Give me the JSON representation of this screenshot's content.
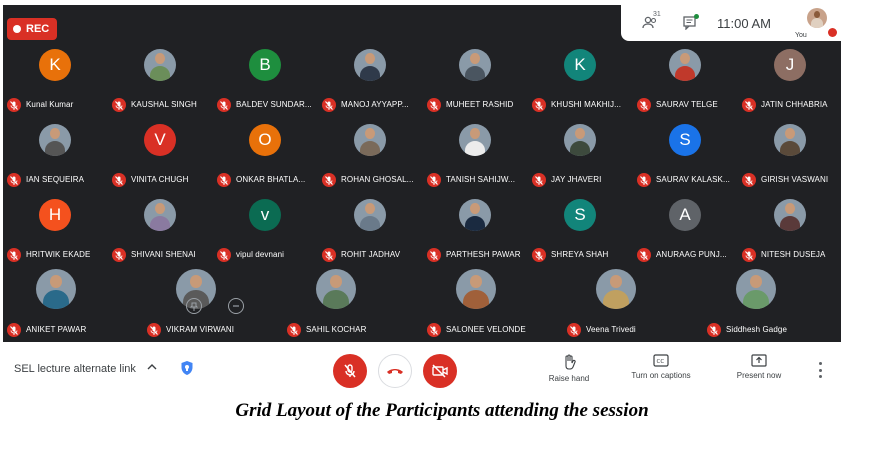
{
  "recording": {
    "label": "REC"
  },
  "top_panel": {
    "participant_count": "31",
    "clock": "11:00 AM",
    "self_label": "You"
  },
  "participants": [
    {
      "name": "Kunal Kumar",
      "avatar": "letter",
      "initial": "K",
      "color": "#e8710a"
    },
    {
      "name": "KAUSHAL SINGH",
      "avatar": "photo",
      "color": "#6b8e5a"
    },
    {
      "name": "BALDEV SUNDAR...",
      "avatar": "letter",
      "initial": "B",
      "color": "#1e8e3e"
    },
    {
      "name": "MANOJ AYYAPP...",
      "avatar": "photo",
      "color": "#2f3a4a"
    },
    {
      "name": "MUHEET RASHID",
      "avatar": "photo",
      "color": "#4a5560"
    },
    {
      "name": "KHUSHI MAKHIJ...",
      "avatar": "letter",
      "initial": "K",
      "color": "#12857a"
    },
    {
      "name": "SAURAV TELGE",
      "avatar": "photo",
      "color": "#c0392b"
    },
    {
      "name": "JATIN CHHABRIA",
      "avatar": "letter",
      "initial": "J",
      "color": "#8d6e63"
    },
    {
      "name": "IAN SEQUEIRA",
      "avatar": "photo",
      "color": "#555555"
    },
    {
      "name": "VINITA CHUGH",
      "avatar": "letter",
      "initial": "V",
      "color": "#d93025"
    },
    {
      "name": "ONKAR BHATLA...",
      "avatar": "letter",
      "initial": "O",
      "color": "#e8710a"
    },
    {
      "name": "ROHAN GHOSAL...",
      "avatar": "photo",
      "color": "#7a6a5a"
    },
    {
      "name": "TANISH SAHIJW...",
      "avatar": "photo",
      "color": "#ececec"
    },
    {
      "name": "JAY JHAVERI",
      "avatar": "photo",
      "color": "#3d4a3d"
    },
    {
      "name": "SAURAV KALASK...",
      "avatar": "letter",
      "initial": "S",
      "color": "#1a73e8"
    },
    {
      "name": "GIRISH VASWANI",
      "avatar": "photo",
      "color": "#5a4a3a"
    },
    {
      "name": "HRITWIK EKADE",
      "avatar": "letter",
      "initial": "H",
      "color": "#f4511e"
    },
    {
      "name": "SHIVANI SHENAI",
      "avatar": "photo",
      "color": "#8a7aa0"
    },
    {
      "name": "vipul devnani",
      "avatar": "letter",
      "initial": "v",
      "color": "#0b6b52"
    },
    {
      "name": "ROHIT JADHAV",
      "avatar": "photo",
      "color": "#6a7a8a"
    },
    {
      "name": "PARTHESH PAWAR",
      "avatar": "photo",
      "color": "#1a2a40"
    },
    {
      "name": "SHREYA SHAH",
      "avatar": "letter",
      "initial": "S",
      "color": "#12857a"
    },
    {
      "name": "ANURAAG PUNJ...",
      "avatar": "letter",
      "initial": "A",
      "color": "#5f6368"
    },
    {
      "name": "NITESH DUSEJA",
      "avatar": "photo",
      "color": "#5a3a3a"
    },
    {
      "name": "ANIKET PAWAR",
      "avatar": "photo",
      "color": "#2a6a8a"
    },
    {
      "name": "VIKRAM VIRWANI",
      "avatar": "photo",
      "color": "#5a5a5a"
    },
    {
      "name": "SAHIL KOCHAR",
      "avatar": "photo",
      "color": "#5a7a5a"
    },
    {
      "name": "SALONEE VELONDE",
      "avatar": "photo",
      "color": "#a0603a"
    },
    {
      "name": "Veena Trivedi",
      "avatar": "photo",
      "color": "#c0a060"
    },
    {
      "name": "Siddhesh Gadge",
      "avatar": "photo",
      "color": "#6a9a6a"
    }
  ],
  "bottom_bar": {
    "meeting_title": "SEL lecture alternate link",
    "raise_hand": "Raise hand",
    "captions": "Turn on captions",
    "present_now": "Present now"
  },
  "caption": "Grid Layout of the Participants attending the session"
}
